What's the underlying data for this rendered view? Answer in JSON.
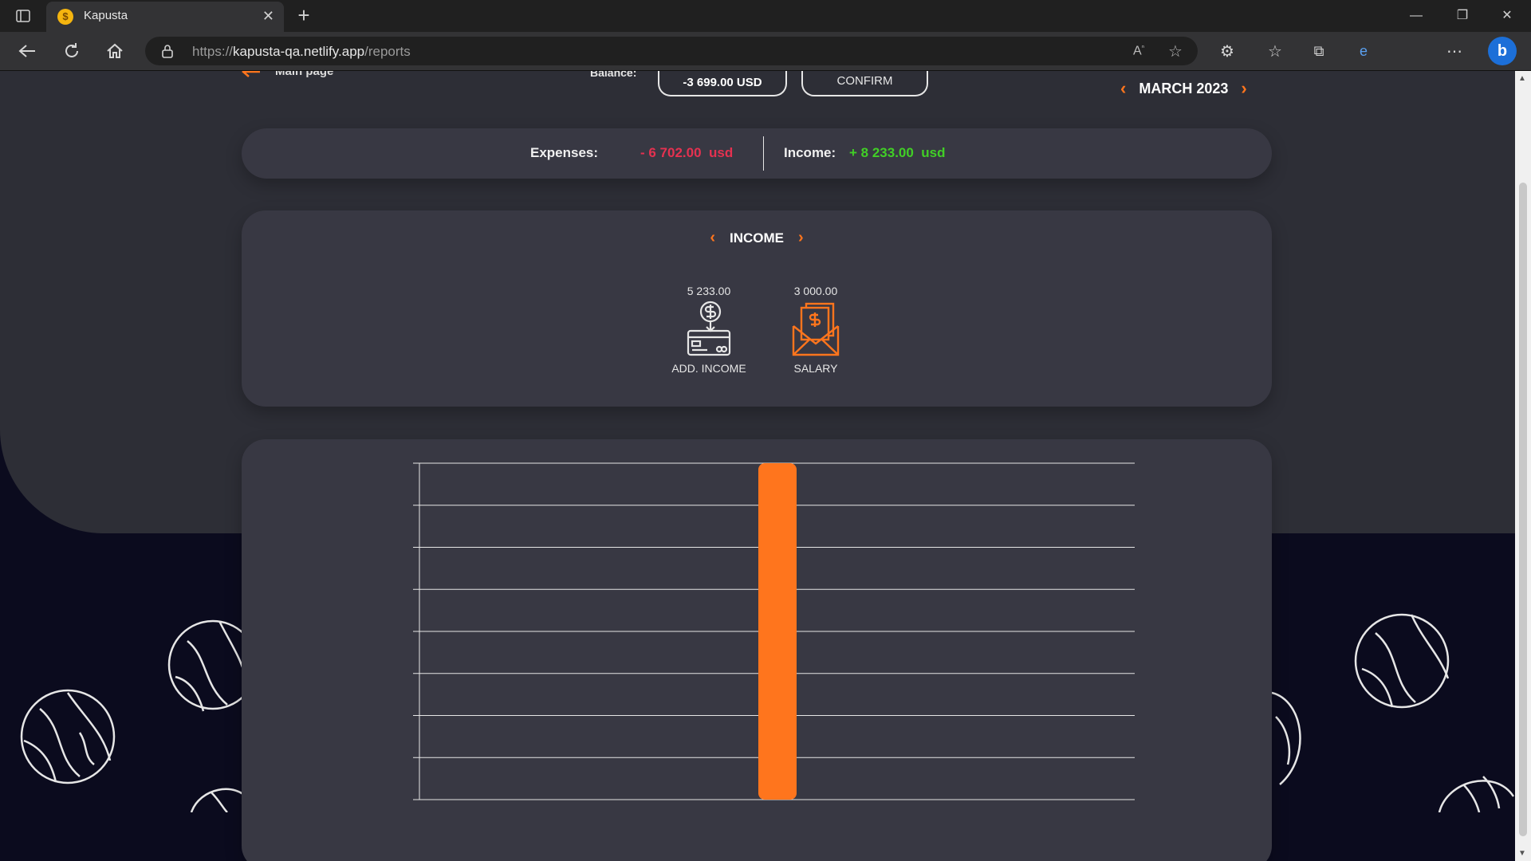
{
  "browser": {
    "tab_title": "Kapusta",
    "url_prefix": "https://",
    "url_host": "kapusta-qa.netlify.app",
    "url_path": "/reports"
  },
  "header": {
    "back_label": "Main page",
    "balance_label": "Balance:",
    "balance_value": "-3 699.00 USD",
    "confirm_label": "CONFIRM",
    "month": "MARCH 2023"
  },
  "summary": {
    "expenses_label": "Expenses:",
    "expenses_value": "- 6 702.00  usd",
    "income_label": "Income:",
    "income_value": "+ 8 233.00  usd"
  },
  "categories": {
    "title": "INCOME",
    "items": [
      {
        "amount": "5 233.00",
        "label": "ADD. INCOME",
        "icon": "add-income-icon"
      },
      {
        "amount": "3 000.00",
        "label": "SALARY",
        "icon": "salary-icon"
      }
    ]
  },
  "colors": {
    "accent": "#ff751d",
    "expenses": "#e53150",
    "income": "#41cf26",
    "card": "#383843"
  },
  "chart_data": {
    "type": "bar",
    "categories": [
      ""
    ],
    "values": [
      4000
    ],
    "ylim": [
      0,
      4000
    ],
    "grid": true
  }
}
